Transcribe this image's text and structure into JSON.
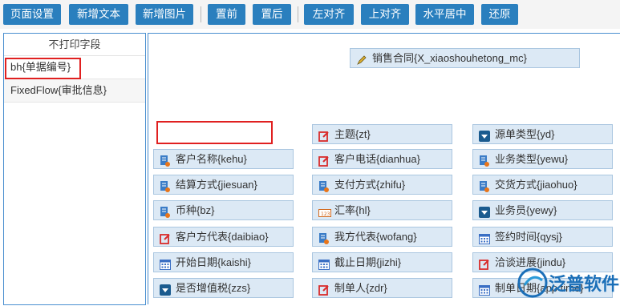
{
  "toolbar": {
    "page_setup": "页面设置",
    "add_text": "新增文本",
    "add_image": "新增图片",
    "bring_front": "置前",
    "send_back": "置后",
    "align_left": "左对齐",
    "align_top": "上对齐",
    "center_h": "水平居中",
    "restore": "还原"
  },
  "left_panel": {
    "title": "不打印字段",
    "items": [
      "bh{单据编号}",
      "FixedFlow{审批信息}"
    ]
  },
  "canvas": {
    "title_field": "销售合同{X_xiaoshouhetong_mc}",
    "fields": [
      {
        "label": "主题{zt}",
        "icon": "edit-icon"
      },
      {
        "label": "源单类型{yd}",
        "icon": "dropdown-icon"
      },
      {
        "label": "客户名称{kehu}",
        "icon": "doc-icon"
      },
      {
        "label": "客户电话{dianhua}",
        "icon": "edit-icon"
      },
      {
        "label": "业务类型{yewu}",
        "icon": "doc-icon"
      },
      {
        "label": "结算方式{jiesuan}",
        "icon": "doc-icon"
      },
      {
        "label": "支付方式{zhifu}",
        "icon": "doc-icon"
      },
      {
        "label": "交货方式{jiaohuo}",
        "icon": "doc-icon"
      },
      {
        "label": "币种{bz}",
        "icon": "doc-icon"
      },
      {
        "label": "汇率{hl}",
        "icon": "number-icon"
      },
      {
        "label": "业务员{yewy}",
        "icon": "dropdown-icon"
      },
      {
        "label": "客户方代表{daibiao}",
        "icon": "edit-icon"
      },
      {
        "label": "我方代表{wofang}",
        "icon": "doc-icon"
      },
      {
        "label": "签约时间{qysj}",
        "icon": "calendar-icon"
      },
      {
        "label": "开始日期{kaishi}",
        "icon": "calendar-icon"
      },
      {
        "label": "截止日期{jizhi}",
        "icon": "calendar-icon"
      },
      {
        "label": "洽谈进展{jindu}",
        "icon": "edit-icon"
      },
      {
        "label": "是否增值税{zzs}",
        "icon": "dropdown-icon"
      },
      {
        "label": "制单人{zdr}",
        "icon": "edit-icon"
      },
      {
        "label": "制单日期{app time}",
        "icon": "calendar-icon"
      }
    ]
  },
  "watermark": {
    "text": "泛普软件"
  },
  "colors": {
    "toolbar_button": "#2a7fbe",
    "field_bg": "#dce9f5",
    "highlight": "#e02020",
    "panel_border": "#4a8fd0"
  }
}
